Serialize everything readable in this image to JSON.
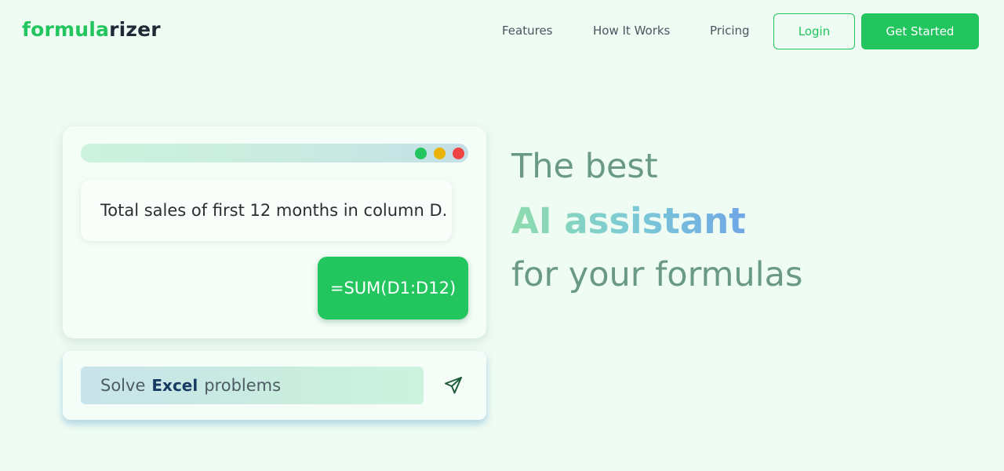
{
  "brand": {
    "logo_part1": "formula",
    "logo_part2": "rizer"
  },
  "nav": {
    "features": "Features",
    "how_it_works": "How It Works",
    "pricing": "Pricing",
    "login": "Login",
    "get_started": "Get Started"
  },
  "demo": {
    "user_message": "Total sales of first 12 months in column D.",
    "formula_reply": "=SUM(D1:D12)"
  },
  "prompt": {
    "pre": "Solve",
    "highlight": "Excel",
    "post": "problems"
  },
  "hero": {
    "line1": "The best",
    "line2": "AI assistant",
    "line3": "for your formulas"
  },
  "icons": {
    "send": "send-icon",
    "window_dots": [
      "green",
      "yellow",
      "red"
    ]
  },
  "colors": {
    "accent": "#22c55e",
    "background": "#effcf3",
    "headline": "#6a9a85"
  }
}
